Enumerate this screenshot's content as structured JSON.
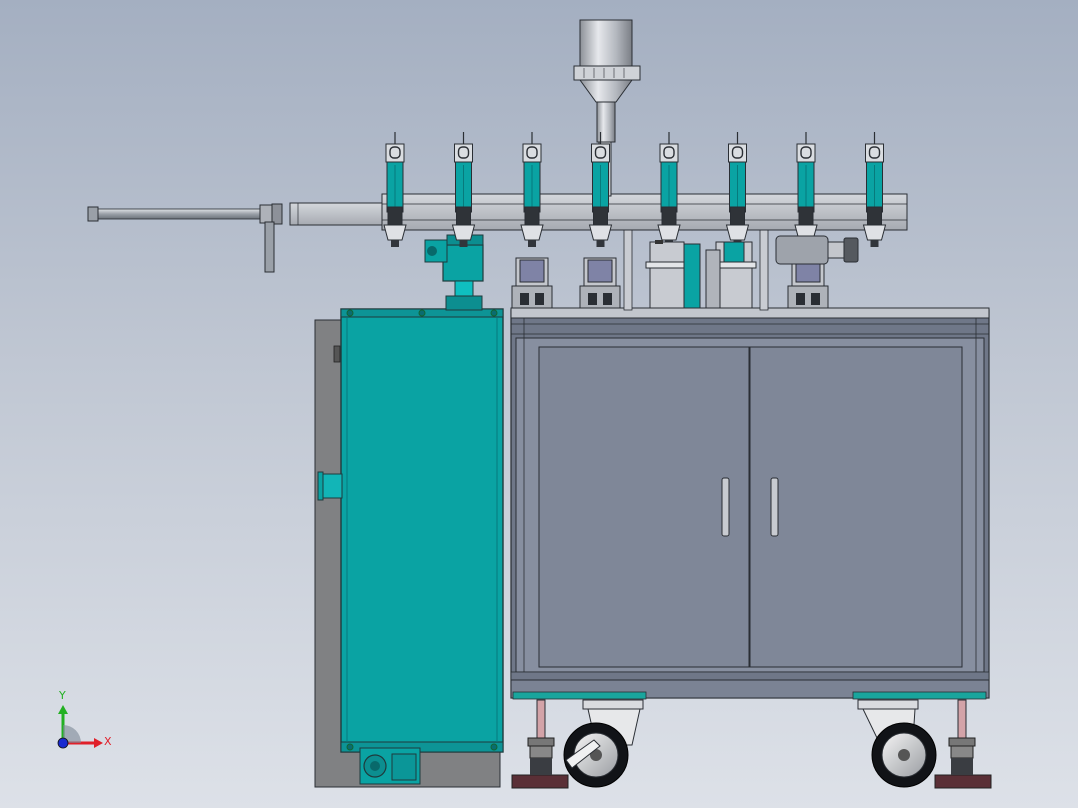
{
  "viewport": {
    "background_top": "#a4afc1",
    "background_bottom": "#dde1e8"
  },
  "model": {
    "colors": {
      "teal": "#0aa3a3",
      "teal_dark": "#077a7c",
      "cabinet": "#7f8798",
      "frame": "#6f7788",
      "steel": "#b8bcc4",
      "dark": "#2a2e34"
    },
    "nozzle_count": 8
  },
  "triad": {
    "x_label": "X",
    "y_label": "Y",
    "x_color": "#e0202a",
    "y_color": "#22b022",
    "z_color": "#1a2ad0"
  }
}
